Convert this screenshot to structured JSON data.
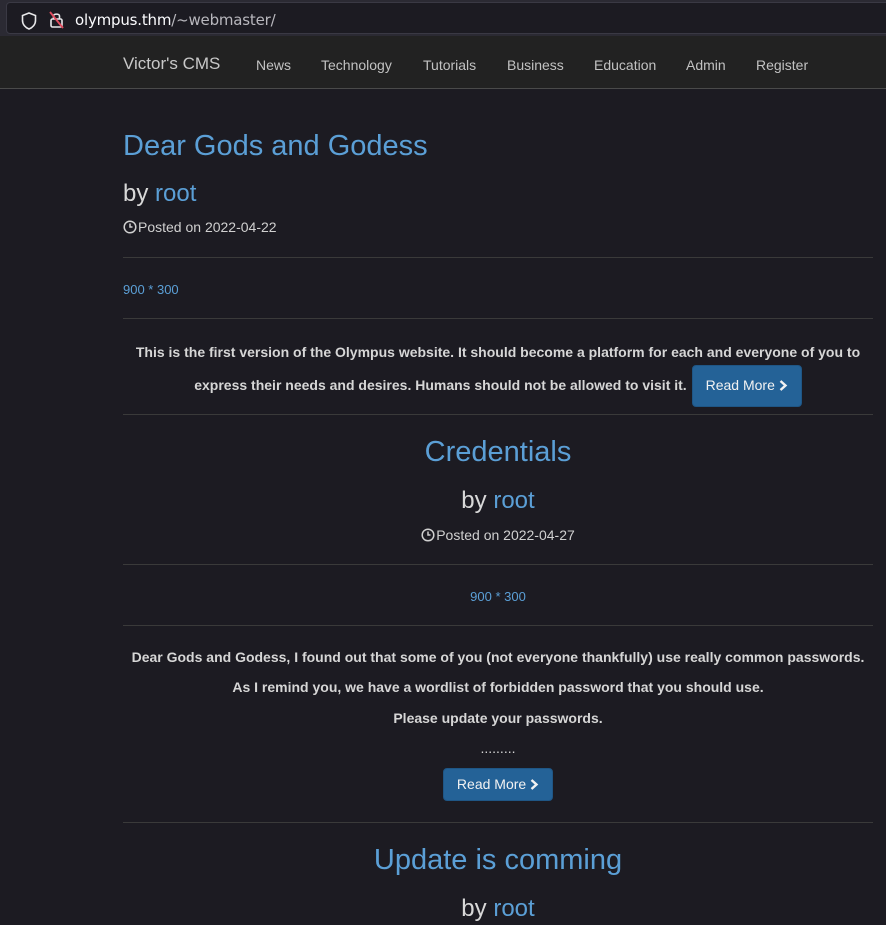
{
  "browser": {
    "url_host": "olympus.thm",
    "url_path": "/~webmaster/"
  },
  "navbar": {
    "brand": "Victor's CMS",
    "links": [
      "News",
      "Technology",
      "Tutorials",
      "Business",
      "Education",
      "Admin",
      "Register"
    ]
  },
  "posts": [
    {
      "title": "Dear Gods and Godess",
      "by": "by",
      "author": "root",
      "posted": "Posted on 2022-04-22",
      "image_placeholder": "900 * 300",
      "excerpt": "This is the first version of the Olympus website. It should become a platform for each and everyone of you to express their needs and desires. Humans should not be allowed to visit it.",
      "read_more": "Read More"
    },
    {
      "title": "Credentials",
      "by": "by",
      "author": "root",
      "posted": "Posted on 2022-04-27",
      "image_placeholder": "900 * 300",
      "excerpt_lines": [
        "Dear Gods and Godess, I found out that some of you (not everyone thankfully) use really common passwords.",
        "As I remind you, we have a wordlist of forbidden password that you should use.",
        "Please update your passwords.",
        "........."
      ],
      "read_more": "Read More"
    },
    {
      "title": "Update is comming",
      "by": "by",
      "author": "root"
    }
  ]
}
